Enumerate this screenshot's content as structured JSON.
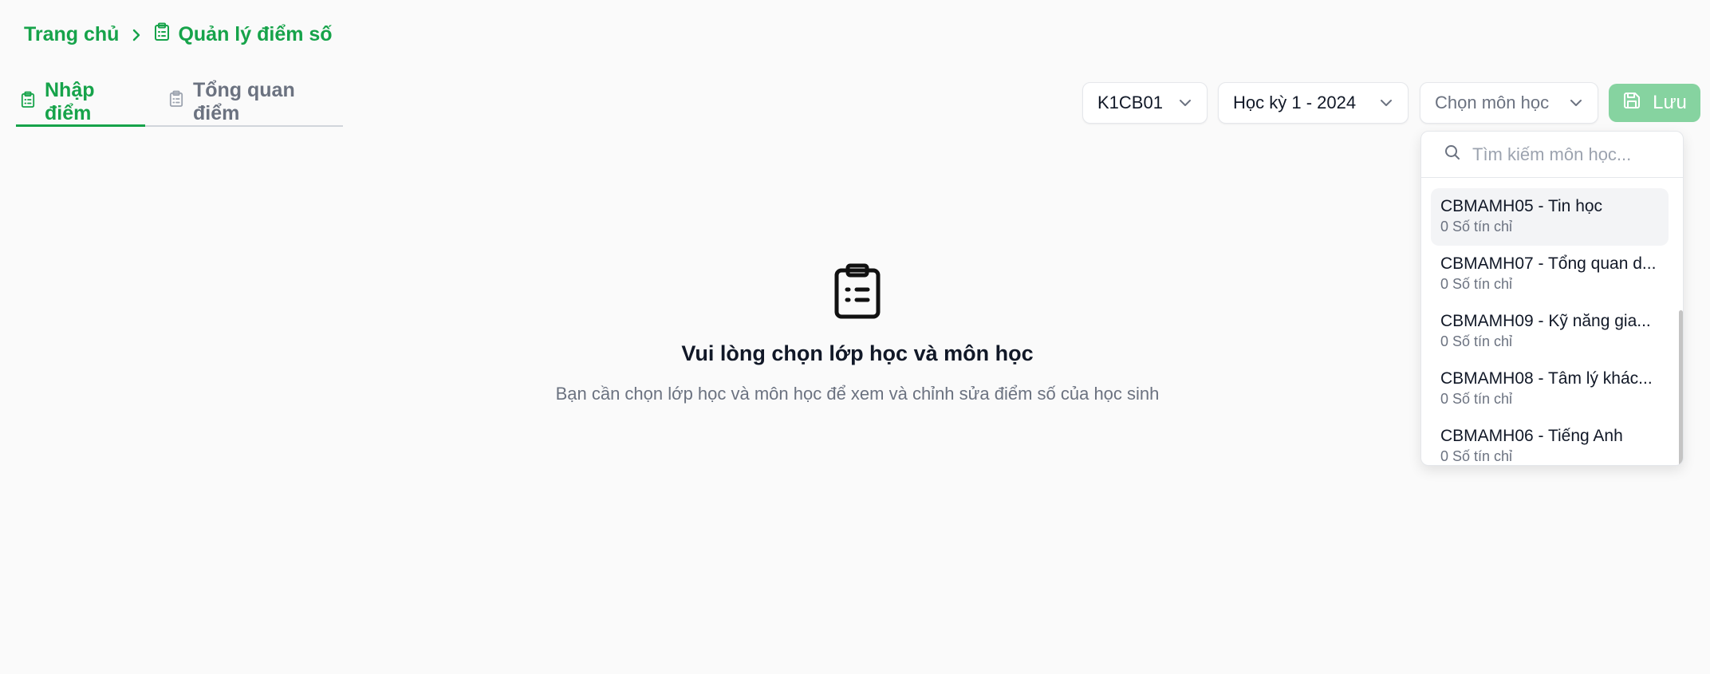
{
  "breadcrumb": {
    "home": "Trang chủ",
    "current": "Quản lý điểm số"
  },
  "tabs": [
    {
      "label": "Nhập điểm",
      "active": true
    },
    {
      "label": "Tổng quan điểm",
      "active": false
    }
  ],
  "toolbar": {
    "class_select": "K1CB01",
    "semester_select": "Học kỳ 1 - 2024",
    "subject_select_placeholder": "Chọn môn học",
    "save_label": "Lưu"
  },
  "subject_dropdown": {
    "search_placeholder": "Tìm kiếm môn học...",
    "items": [
      {
        "name": "CBMAMH05 - Tin học",
        "credits": "0 Số tín chỉ"
      },
      {
        "name": "CBMAMH07 - Tổng quan d...",
        "credits": "0 Số tín chỉ"
      },
      {
        "name": "CBMAMH09 - Kỹ năng gia...",
        "credits": "0 Số tín chỉ"
      },
      {
        "name": "CBMAMH08 - Tâm lý khác...",
        "credits": "0 Số tín chỉ"
      },
      {
        "name": "CBMAMH06 - Tiếng Anh",
        "credits": "0 Số tín chỉ"
      }
    ]
  },
  "empty_state": {
    "title": "Vui lòng chọn lớp học và môn học",
    "description": "Bạn cần chọn lớp học và môn học để xem và chỉnh sửa điểm số của học sinh"
  },
  "colors": {
    "accent": "#16a34a",
    "save_button_disabled": "#86d3a0",
    "background": "#fafafa"
  }
}
